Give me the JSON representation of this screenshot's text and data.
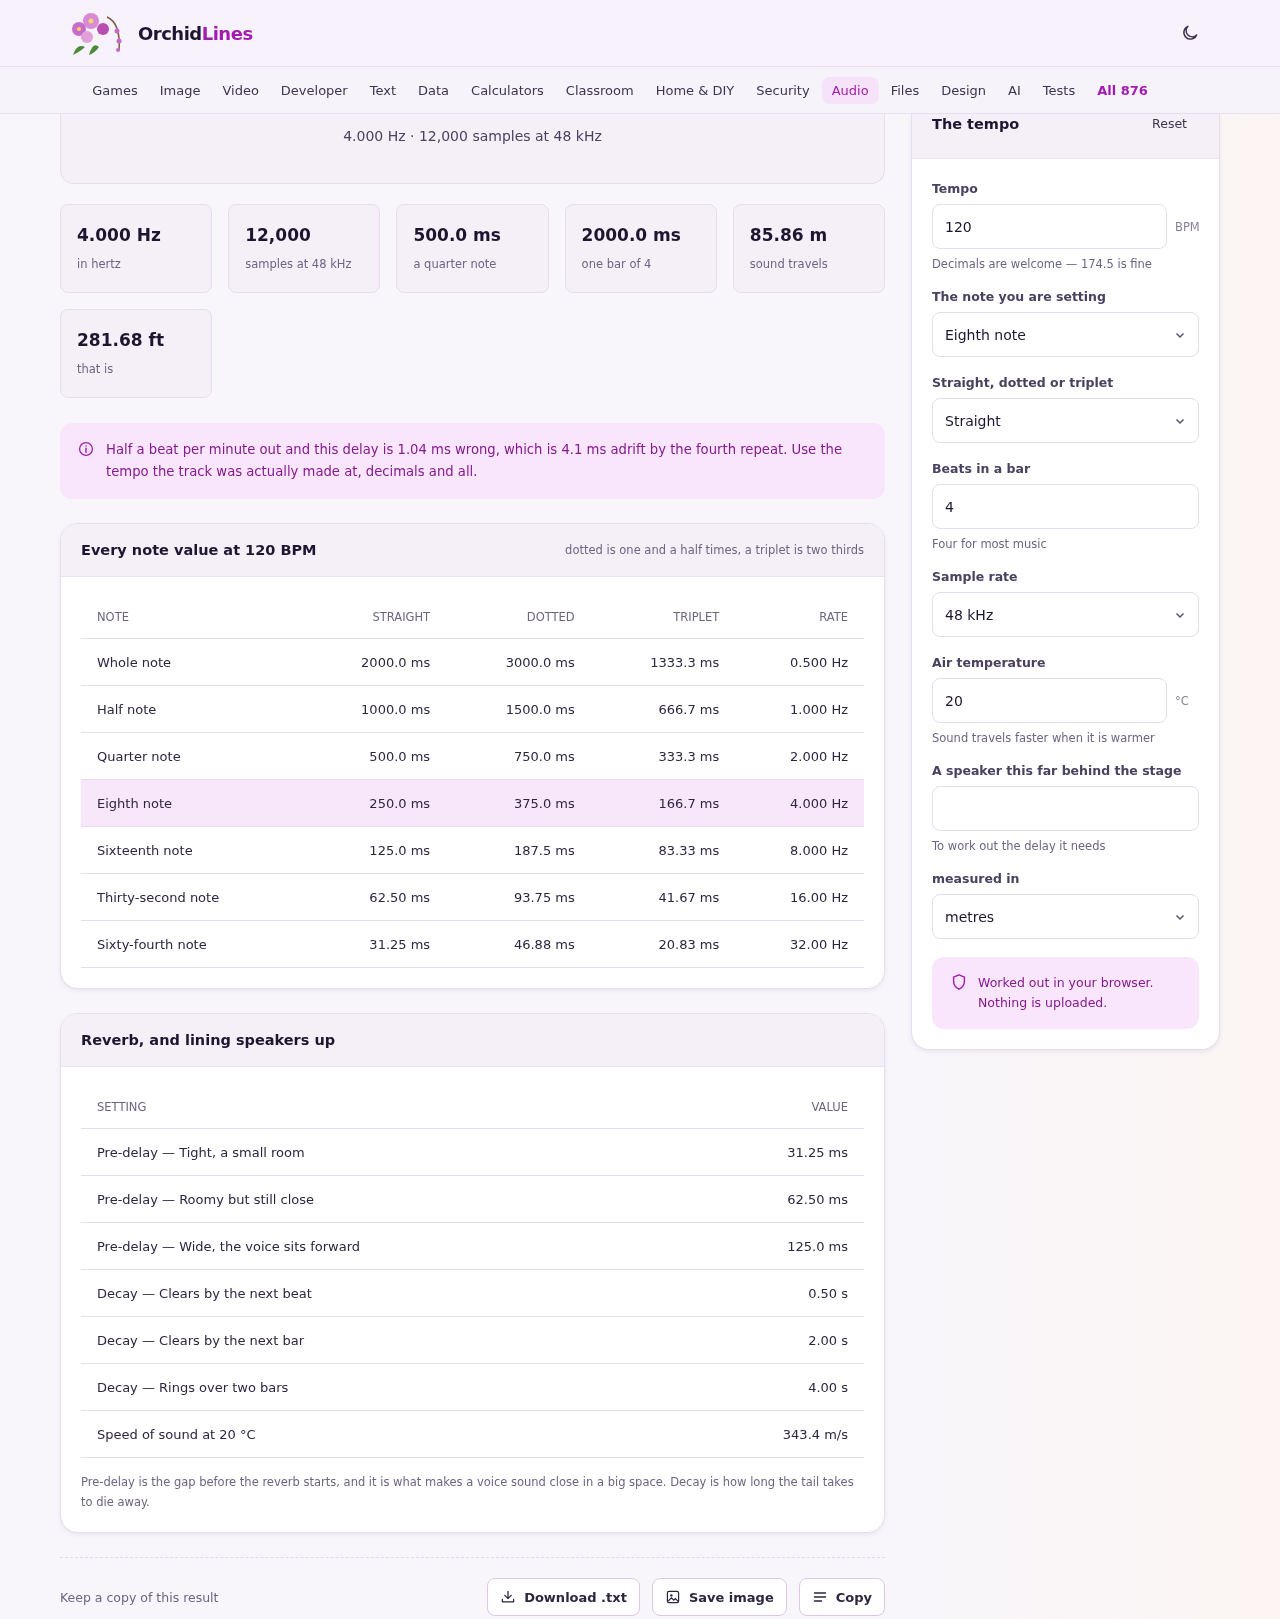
{
  "brand": {
    "first": "Orchid",
    "second": "Lines"
  },
  "nav": [
    {
      "label": "Games",
      "selected": false
    },
    {
      "label": "Image",
      "selected": false
    },
    {
      "label": "Video",
      "selected": false
    },
    {
      "label": "Developer",
      "selected": false
    },
    {
      "label": "Text",
      "selected": false
    },
    {
      "label": "Data",
      "selected": false
    },
    {
      "label": "Calculators",
      "selected": false
    },
    {
      "label": "Classroom",
      "selected": false
    },
    {
      "label": "Home & DIY",
      "selected": false
    },
    {
      "label": "Security",
      "selected": false
    },
    {
      "label": "Audio",
      "selected": true
    },
    {
      "label": "Files",
      "selected": false
    },
    {
      "label": "Design",
      "selected": false
    },
    {
      "label": "AI",
      "selected": false
    },
    {
      "label": "Tests",
      "selected": false
    },
    {
      "label": "All 876",
      "selected": false,
      "kind": "all"
    }
  ],
  "summary": "4.000 Hz · 12,000 samples at 48 kHz",
  "stats": [
    {
      "value": "4.000 Hz",
      "label": "in hertz"
    },
    {
      "value": "12,000",
      "label": "samples at 48 kHz"
    },
    {
      "value": "500.0 ms",
      "label": "a quarter note"
    },
    {
      "value": "2000.0 ms",
      "label": "one bar of 4"
    },
    {
      "value": "85.86 m",
      "label": "sound travels"
    },
    {
      "value": "281.68 ft",
      "label": "that is"
    }
  ],
  "alert": "Half a beat per minute out and this delay is 1.04 ms wrong, which is 4.1 ms adrift by the fourth repeat. Use the tempo the track was actually made at, decimals and all.",
  "notes_table": {
    "title": "Every note value at 120 BPM",
    "subtitle": "dotted is one and a half times, a triplet is two thirds",
    "columns": [
      "NOTE",
      "STRAIGHT",
      "DOTTED",
      "TRIPLET",
      "RATE"
    ],
    "rows": [
      {
        "cells": [
          "Whole note",
          "2000.0 ms",
          "3000.0 ms",
          "1333.3 ms",
          "0.500 Hz"
        ],
        "selected": false
      },
      {
        "cells": [
          "Half note",
          "1000.0 ms",
          "1500.0 ms",
          "666.7 ms",
          "1.000 Hz"
        ],
        "selected": false
      },
      {
        "cells": [
          "Quarter note",
          "500.0 ms",
          "750.0 ms",
          "333.3 ms",
          "2.000 Hz"
        ],
        "selected": false
      },
      {
        "cells": [
          "Eighth note",
          "250.0 ms",
          "375.0 ms",
          "166.7 ms",
          "4.000 Hz"
        ],
        "selected": true
      },
      {
        "cells": [
          "Sixteenth note",
          "125.0 ms",
          "187.5 ms",
          "83.33 ms",
          "8.000 Hz"
        ],
        "selected": false
      },
      {
        "cells": [
          "Thirty-second note",
          "62.50 ms",
          "93.75 ms",
          "41.67 ms",
          "16.00 Hz"
        ],
        "selected": false
      },
      {
        "cells": [
          "Sixty-fourth note",
          "31.25 ms",
          "46.88 ms",
          "20.83 ms",
          "32.00 Hz"
        ],
        "selected": false
      }
    ]
  },
  "reverb_table": {
    "title": "Reverb, and lining speakers up",
    "columns": [
      "SETTING",
      "VALUE"
    ],
    "rows": [
      [
        "Pre-delay — Tight, a small room",
        "31.25 ms"
      ],
      [
        "Pre-delay — Roomy but still close",
        "62.50 ms"
      ],
      [
        "Pre-delay — Wide, the voice sits forward",
        "125.0 ms"
      ],
      [
        "Decay — Clears by the next beat",
        "0.50 s"
      ],
      [
        "Decay — Clears by the next bar",
        "2.00 s"
      ],
      [
        "Decay — Rings over two bars",
        "4.00 s"
      ],
      [
        "Speed of sound at 20 °C",
        "343.4 m/s"
      ]
    ],
    "note": "Pre-delay is the gap before the reverb starts, and it is what makes a voice sound close in a big space. Decay is how long the tail takes to die away."
  },
  "footer": {
    "label": "Keep a copy of this result",
    "buttons": [
      {
        "label": "Download .txt",
        "kind": "download"
      },
      {
        "label": "Save image",
        "kind": "image"
      },
      {
        "label": "Copy",
        "kind": "copy"
      }
    ]
  },
  "panel": {
    "title": "The tempo",
    "reset": "Reset",
    "fields": [
      {
        "kind": "input",
        "label": "Tempo",
        "value": "120",
        "unit": "BPM",
        "hint": "Decimals are welcome — 174.5 is fine"
      },
      {
        "kind": "select",
        "label": "The note you are setting",
        "value": "Eighth note"
      },
      {
        "kind": "select",
        "label": "Straight, dotted or triplet",
        "value": "Straight"
      },
      {
        "kind": "input",
        "label": "Beats in a bar",
        "value": "4",
        "hint": "Four for most music"
      },
      {
        "kind": "select",
        "label": "Sample rate",
        "value": "48 kHz"
      },
      {
        "kind": "input",
        "label": "Air temperature",
        "value": "20",
        "unit": "°C",
        "hint": "Sound travels faster when it is warmer"
      },
      {
        "kind": "input",
        "label": "A speaker this far behind the stage",
        "hint": "To work out the delay it needs"
      },
      {
        "kind": "select",
        "label": "measured in",
        "value": "metres"
      }
    ],
    "privacy": "Worked out in your browser. Nothing is uploaded."
  }
}
